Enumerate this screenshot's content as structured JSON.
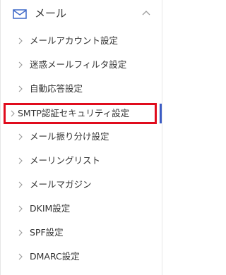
{
  "header": {
    "label": "メール",
    "icon": "mail-icon",
    "toggle_icon": "chevron-up-icon"
  },
  "menu": {
    "items": [
      {
        "label": "メールアカウント設定",
        "active": false
      },
      {
        "label": "迷惑メールフィルタ設定",
        "active": false
      },
      {
        "label": "自動応答設定",
        "active": false
      },
      {
        "label": "SMTP認証セキュリティ設定",
        "active": true
      },
      {
        "label": "メール振り分け設定",
        "active": false
      },
      {
        "label": "メーリングリスト",
        "active": false
      },
      {
        "label": "メールマガジン",
        "active": false
      },
      {
        "label": "DKIM設定",
        "active": false
      },
      {
        "label": "SPF設定",
        "active": false
      },
      {
        "label": "DMARC設定",
        "active": false
      }
    ]
  },
  "colors": {
    "accent": "#3b5cc4",
    "highlight": "#e00c1d",
    "text": "#333333",
    "icon": "#3d68c8",
    "chevron": "#999999"
  }
}
